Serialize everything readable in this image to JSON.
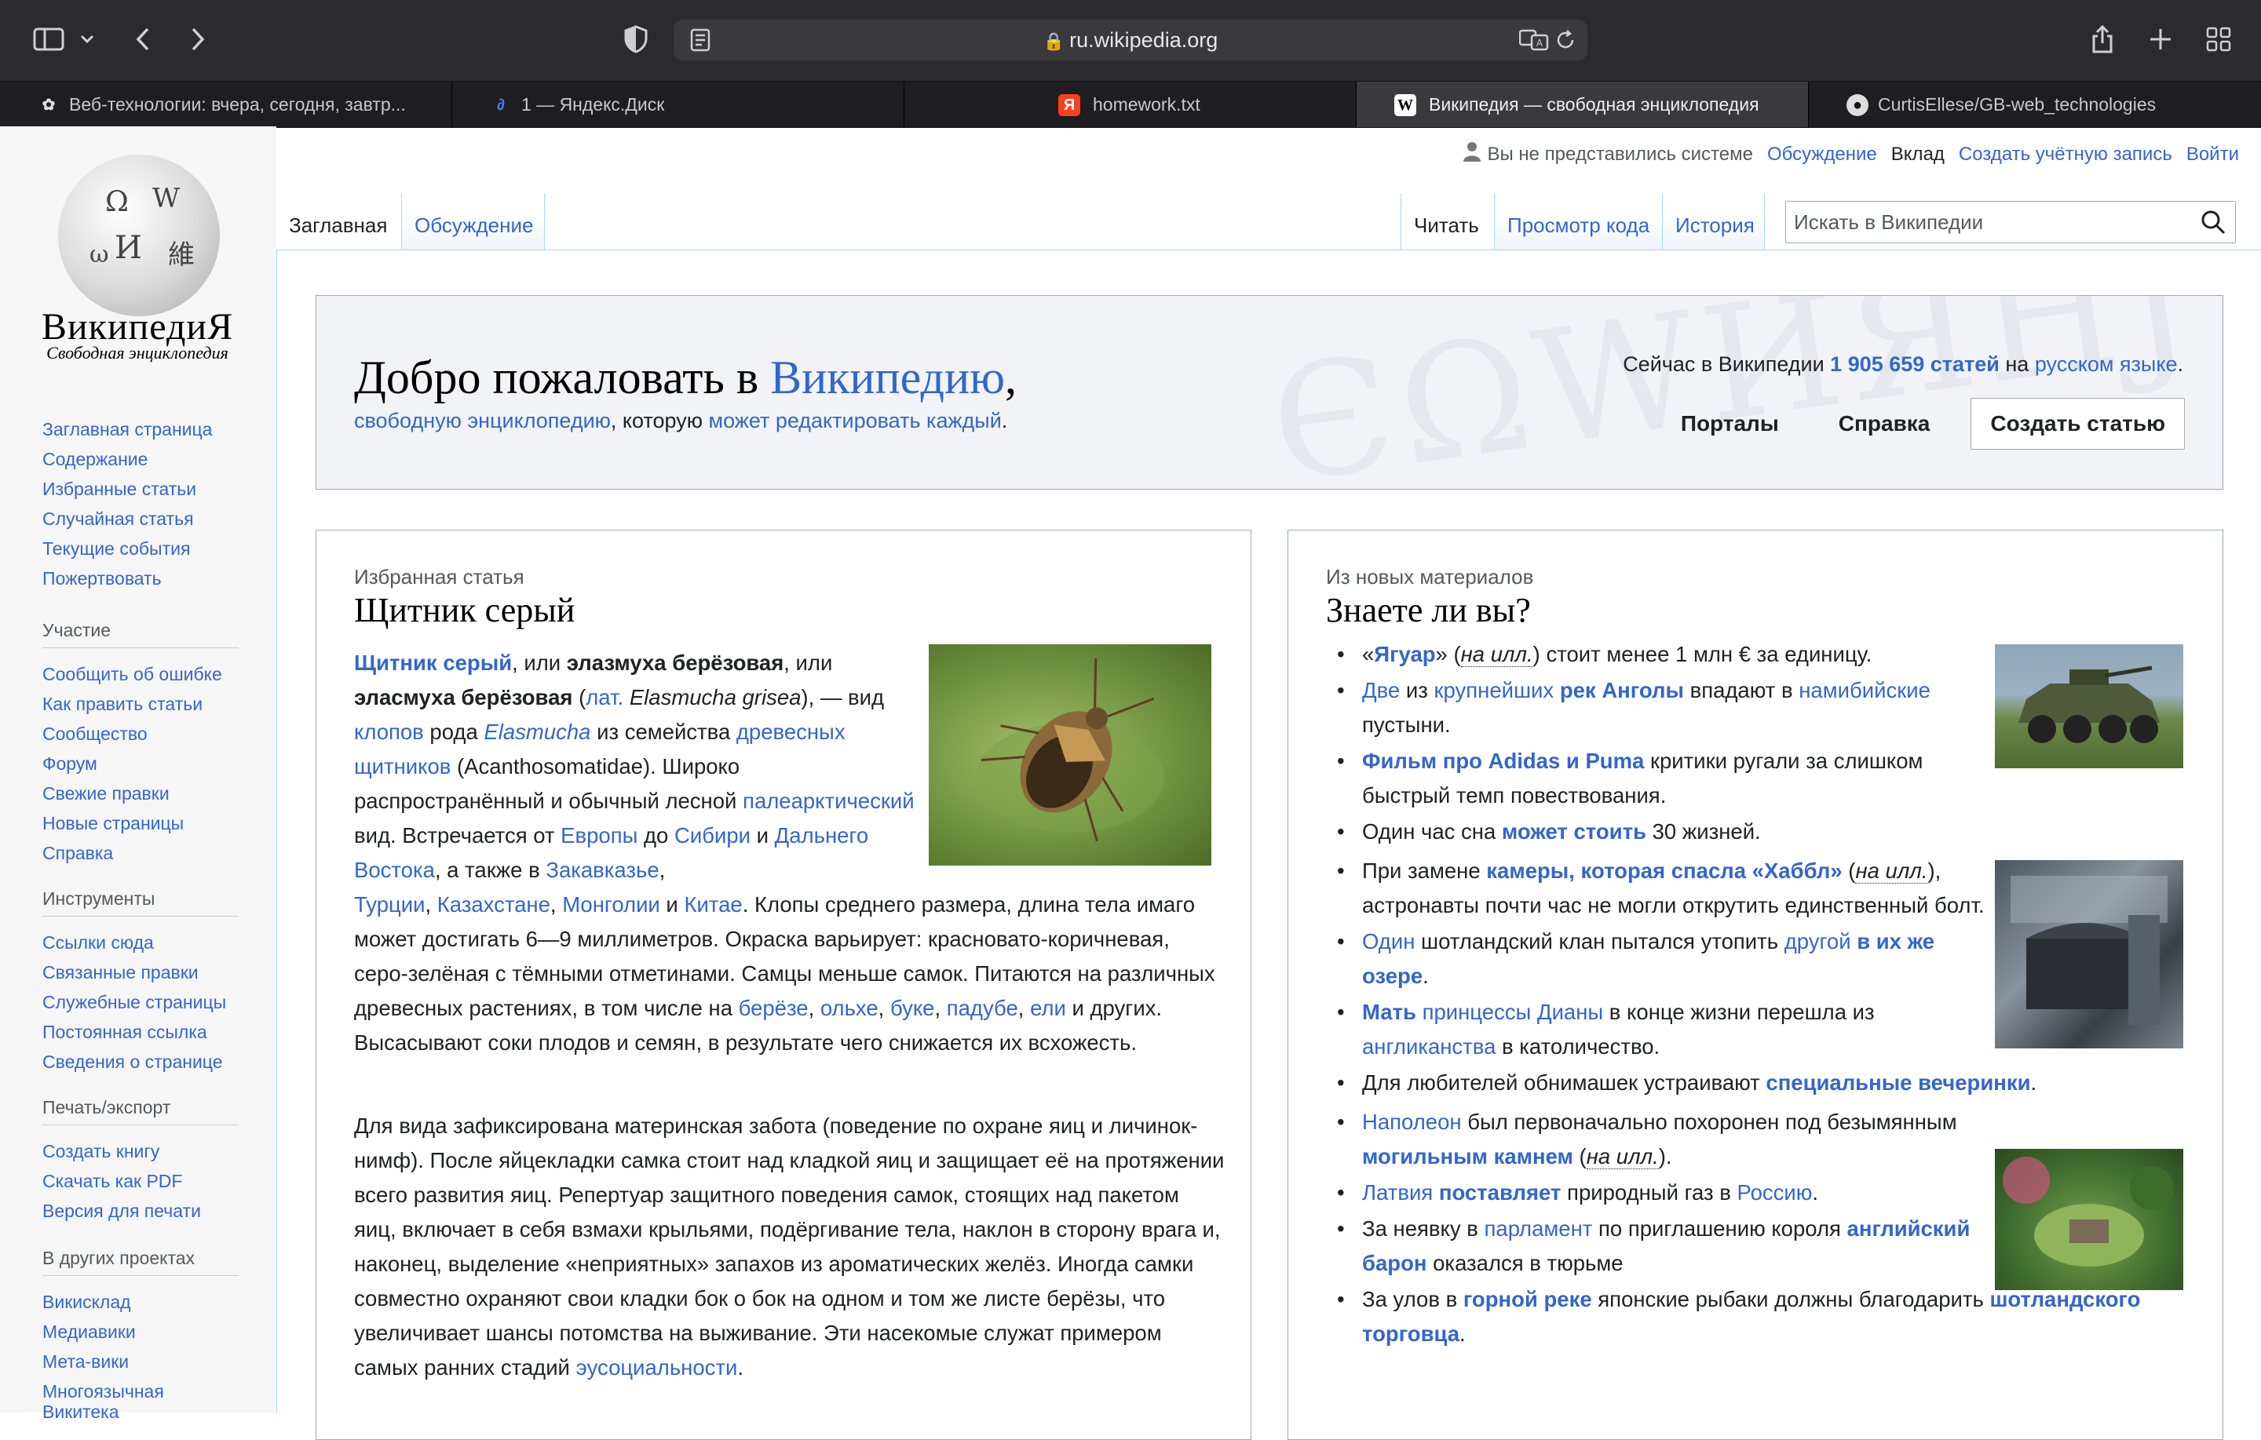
{
  "browser": {
    "url": "ru.wikipedia.org",
    "tabs": [
      {
        "title": "Веб-технологии: вчера, сегодня, завтр...",
        "icon": "github-like-icon"
      },
      {
        "title": "1 — Яндекс.Диск",
        "icon": "yandex-disk-icon"
      },
      {
        "title": "homework.txt",
        "icon": "yandex-icon"
      },
      {
        "title": "Википедия — свободная энциклопедия",
        "icon": "wikipedia-icon"
      },
      {
        "title": "CurtisEllese/GB-web_technologies",
        "icon": "github-icon"
      }
    ],
    "active_tab_index": 3
  },
  "logo": {
    "title": "ВикипедиЯ",
    "tagline": "Свободная энциклопедия"
  },
  "personal": {
    "not_logged": "Вы не представились системе",
    "talk": "Обсуждение",
    "contrib": "Вклад",
    "create_account": "Создать учётную запись",
    "login": "Войти"
  },
  "tabs": {
    "main": "Заглавная",
    "talk": "Обсуждение",
    "read": "Читать",
    "view_source": "Просмотр кода",
    "history": "История"
  },
  "search": {
    "placeholder": "Искать в Википедии"
  },
  "sidebar": {
    "nav": [
      "Заглавная страница",
      "Содержание",
      "Избранные статьи",
      "Случайная статья",
      "Текущие события",
      "Пожертвовать"
    ],
    "participation": {
      "heading": "Участие",
      "items": [
        "Сообщить об ошибке",
        "Как править статьи",
        "Сообщество",
        "Форум",
        "Свежие правки",
        "Новые страницы",
        "Справка"
      ]
    },
    "tools": {
      "heading": "Инструменты",
      "items": [
        "Ссылки сюда",
        "Связанные правки",
        "Служебные страницы",
        "Постоянная ссылка",
        "Сведения о странице"
      ]
    },
    "print": {
      "heading": "Печать/экспорт",
      "items": [
        "Создать книгу",
        "Скачать как PDF",
        "Версия для печати"
      ]
    },
    "projects": {
      "heading": "В других проектах",
      "items": [
        "Викисклад",
        "Медиавики",
        "Мета-вики",
        "Многоязычная Викитека"
      ]
    }
  },
  "welcome": {
    "title_prefix": "Добро пожаловать в ",
    "title_link": "Википедию",
    "title_suffix": ",",
    "sub_link1": "свободную энциклопедию",
    "sub_text": ", которую ",
    "sub_link2": "может редактировать каждый",
    "sub_end": ".",
    "stats_prefix": "Сейчас в Википедии ",
    "stats_count": "1 905 659 статей",
    "stats_mid": " на ",
    "stats_lang": "русском языке",
    "stats_end": ".",
    "portals": "Порталы",
    "help": "Справка",
    "create": "Создать статью",
    "background_letters": "ЄΩWИЯHJ"
  },
  "featured": {
    "kicker": "Избранная статья",
    "title": "Щитник серый"
  },
  "dyk": {
    "kicker": "Из новых материалов",
    "title": "Знаете ли вы?"
  },
  "colors": {
    "link": "#3366cc",
    "sidebar_bg": "#f6f6f6",
    "banner_bg": "#f1f3f7",
    "chrome_bg": "#2b2a2f"
  }
}
